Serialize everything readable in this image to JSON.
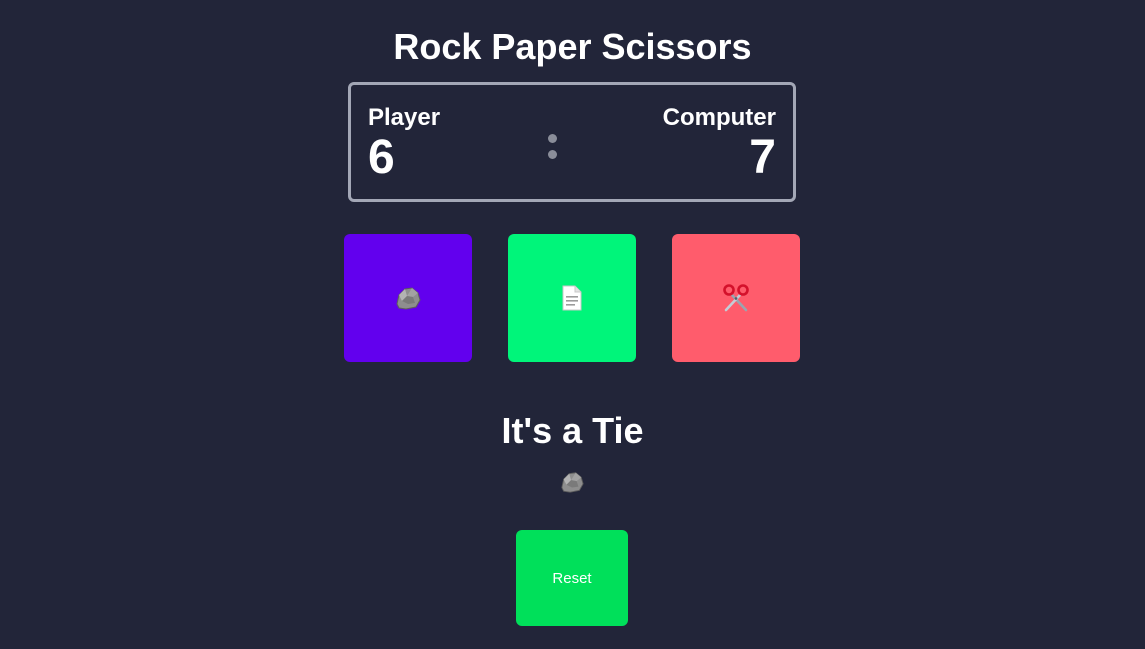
{
  "title": "Rock Paper Scissors",
  "score": {
    "player_label": "Player",
    "player_score": "6",
    "computer_label": "Computer",
    "computer_score": "7"
  },
  "choices": [
    {
      "id": "rock",
      "icon": "rock-icon",
      "color": "#6200ee"
    },
    {
      "id": "paper",
      "icon": "page-icon",
      "color": "#00f57a"
    },
    {
      "id": "scissors",
      "icon": "scissors-icon",
      "color": "#ff5c6c"
    }
  ],
  "result": {
    "text": "It's a Tie",
    "icon": "rock-icon"
  },
  "reset_label": "Reset",
  "colors": {
    "background": "#222539",
    "reset": "#00e05a"
  }
}
